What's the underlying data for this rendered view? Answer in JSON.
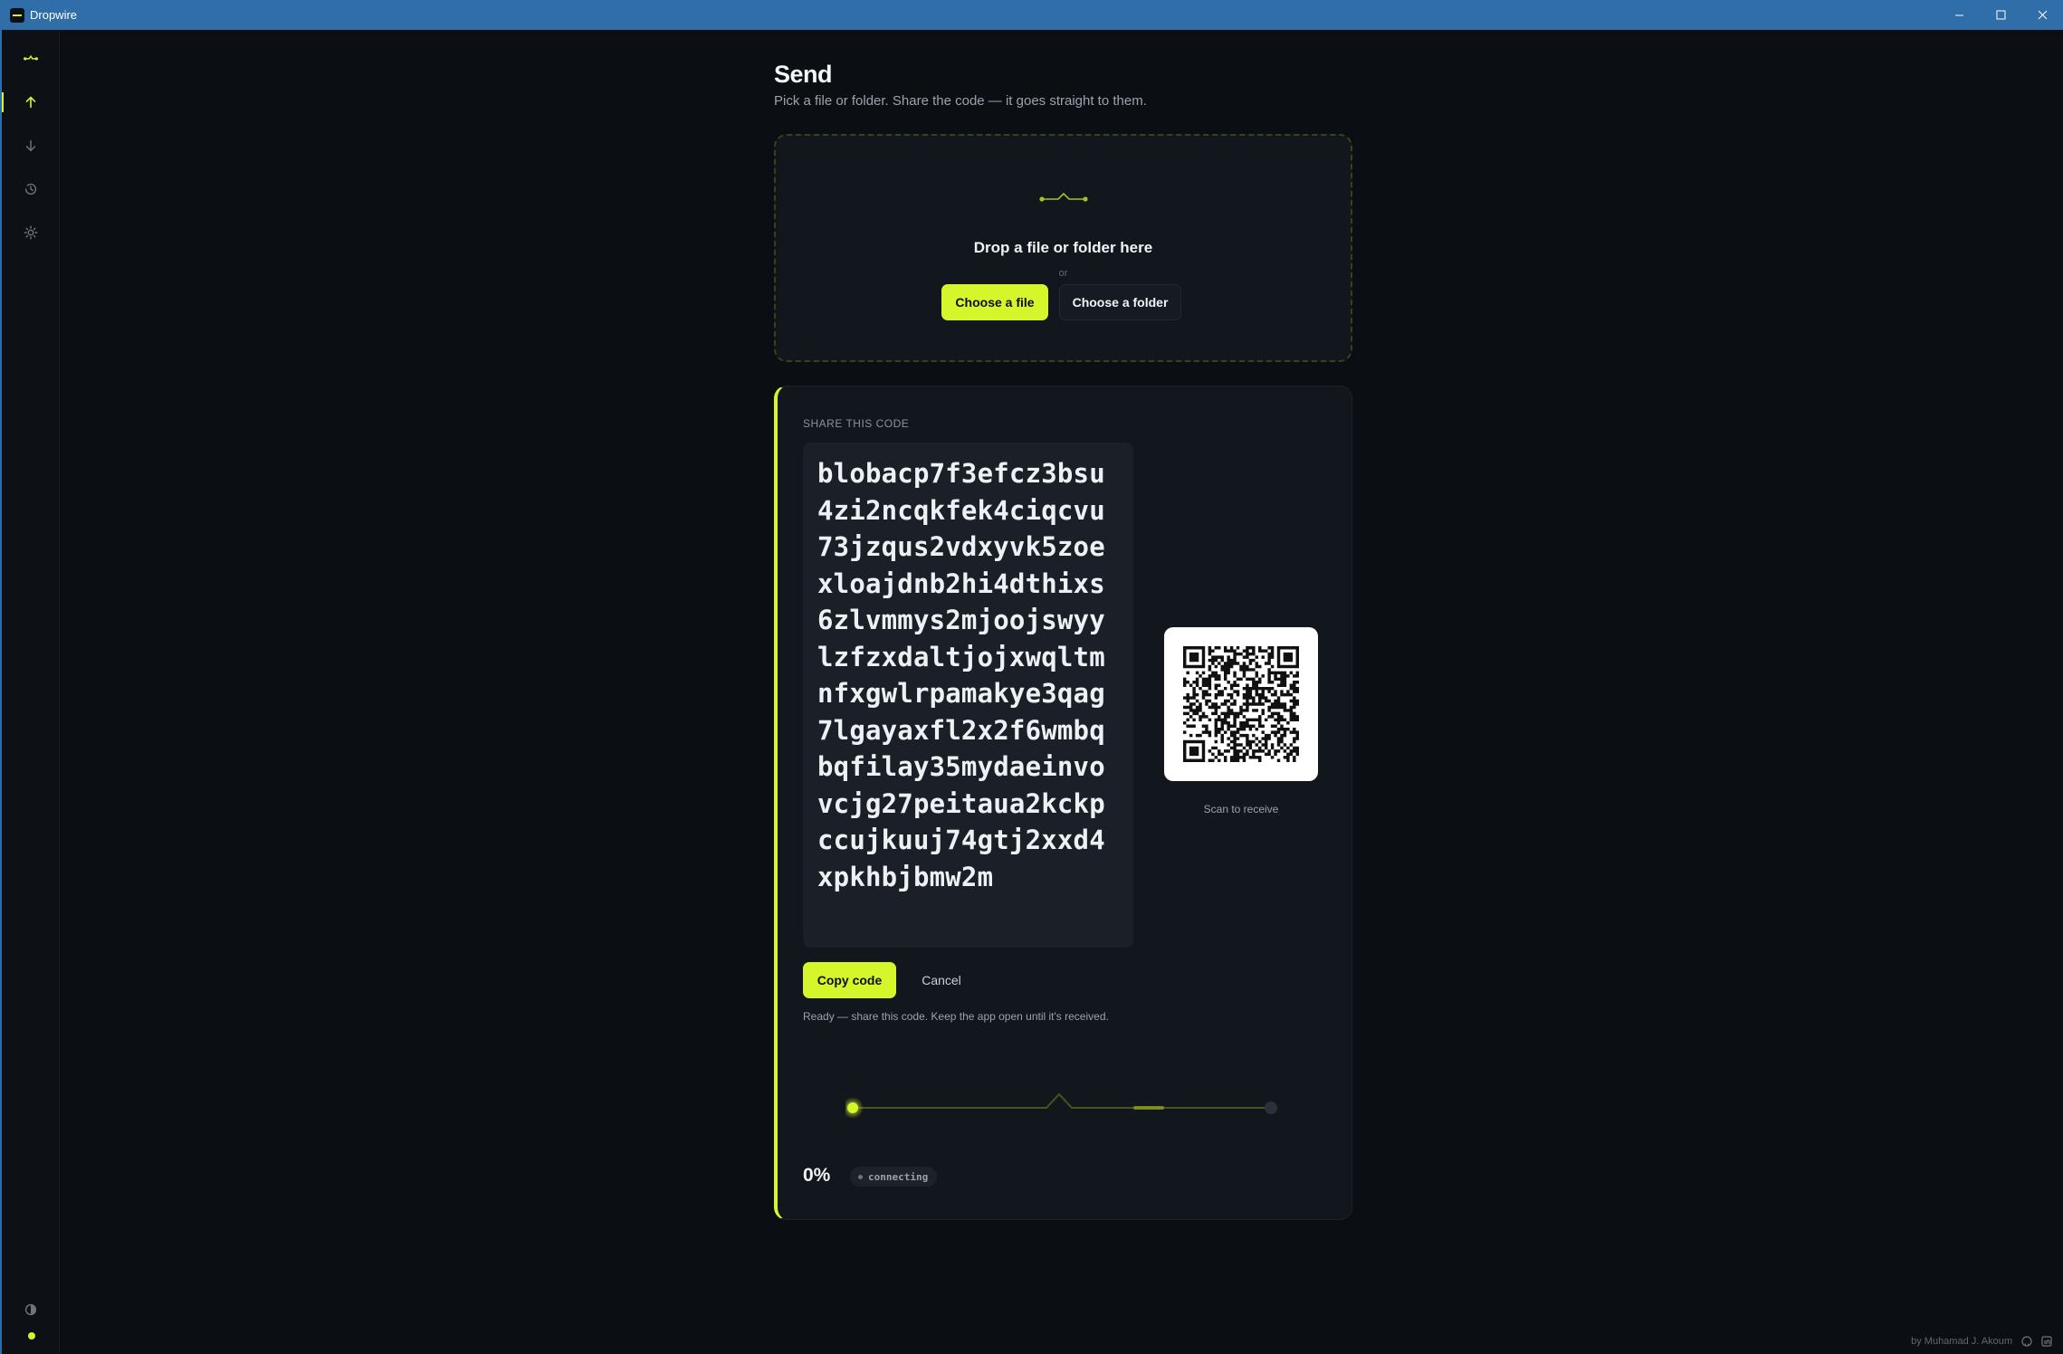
{
  "window": {
    "title": "Dropwire"
  },
  "sidebar": {
    "items": [
      {
        "name": "logo",
        "icon": "dropwire-logo-icon"
      },
      {
        "name": "send",
        "icon": "arrow-up-icon",
        "active": true
      },
      {
        "name": "receive",
        "icon": "arrow-down-icon"
      },
      {
        "name": "history",
        "icon": "history-icon"
      },
      {
        "name": "settings",
        "icon": "gear-icon"
      }
    ],
    "bottom": [
      {
        "name": "theme",
        "icon": "contrast-icon"
      },
      {
        "name": "status",
        "icon": "status-dot-icon"
      }
    ]
  },
  "page": {
    "title": "Send",
    "subtitle": "Pick a file or folder. Share the code — it goes straight to them."
  },
  "dropzone": {
    "title": "Drop a file or folder here",
    "or": "or",
    "choose_file": "Choose a file",
    "choose_folder": "Choose a folder"
  },
  "share": {
    "label": "SHARE THIS CODE",
    "code": "blobacp7f3efcz3bsu4zi2ncqkfek4ciqcvu73jzqus2vdxyvk5zoexloajdnb2hi4dthixs6zlvmmys2mjoojswyylzfzxdaltjojxwqltmnfxgwlrpamakye3qag7lgayaxfl2x2f6wmbqbqfilay35mydaeinvovcjg27peitaua2kckpccujkuuj74gtj2xxd4xpkhbjbmw2m",
    "qr_caption": "Scan to receive",
    "copy_label": "Copy code",
    "cancel_label": "Cancel",
    "status": "Ready — share this code. Keep the app open until it's received.",
    "progress_percent": "0%",
    "progress_value": 0,
    "connection_status": "connecting"
  },
  "footer": {
    "credit": "by Muhamad J. Akoum",
    "icons": [
      "github-icon",
      "linkedin-icon"
    ]
  },
  "colors": {
    "accent": "#d4f62a",
    "background": "#0b0e13",
    "card": "#12161d",
    "titlebar": "#2f6ea9"
  }
}
